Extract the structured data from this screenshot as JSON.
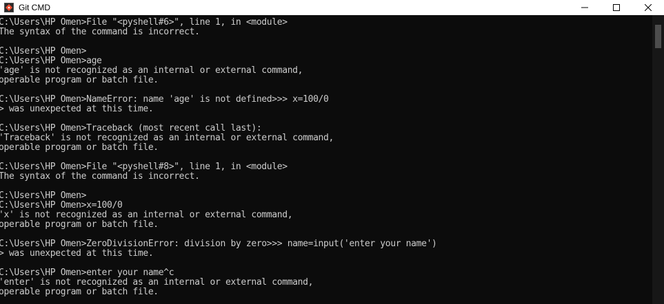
{
  "window": {
    "title": "Git CMD",
    "icon": "git-cmd-icon",
    "controls": [
      "minimize",
      "maximize",
      "close"
    ]
  },
  "console": {
    "lines": [
      "C:\\Users\\HP Omen>File \"<pyshell#6>\", line 1, in <module>",
      "The syntax of the command is incorrect.",
      "",
      "C:\\Users\\HP Omen>",
      "C:\\Users\\HP Omen>age",
      "'age' is not recognized as an internal or external command,",
      "operable program or batch file.",
      "",
      "C:\\Users\\HP Omen>NameError: name 'age' is not defined>>> x=100/0",
      "> was unexpected at this time.",
      "",
      "C:\\Users\\HP Omen>Traceback (most recent call last):",
      "'Traceback' is not recognized as an internal or external command,",
      "operable program or batch file.",
      "",
      "C:\\Users\\HP Omen>File \"<pyshell#8>\", line 1, in <module>",
      "The syntax of the command is incorrect.",
      "",
      "C:\\Users\\HP Omen>",
      "C:\\Users\\HP Omen>x=100/0",
      "'x' is not recognized as an internal or external command,",
      "operable program or batch file.",
      "",
      "C:\\Users\\HP Omen>ZeroDivisionError: division by zero>>> name=input('enter your name')",
      "> was unexpected at this time.",
      "",
      "C:\\Users\\HP Omen>enter your name^c",
      "'enter' is not recognized as an internal or external command,",
      "operable program or batch file."
    ]
  },
  "colors": {
    "background": "#0c0c0c",
    "text": "#cccccc",
    "titlebar": "#ffffff"
  }
}
